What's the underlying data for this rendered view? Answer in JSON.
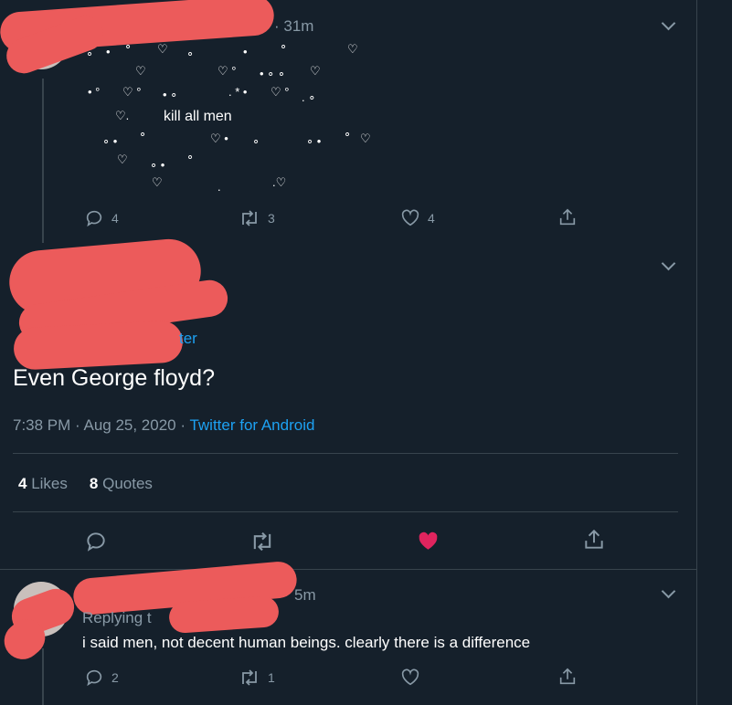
{
  "tweet1": {
    "time": "· 31m",
    "text": "kill all men",
    "actions": {
      "replies": "4",
      "retweets": "3",
      "likes": "4"
    }
  },
  "main_tweet": {
    "replying_fragment": "ter",
    "text": "Even George floyd?",
    "timestamp": "7:38 PM · Aug 25, 2020 · ",
    "source": "Twitter for Android",
    "stats": {
      "likes_count": "4",
      "likes_label": "Likes",
      "quotes_count": "8",
      "quotes_label": "Quotes"
    },
    "liked": true,
    "like_color": "#e0245e"
  },
  "tweet3": {
    "time": "5m",
    "replying_label": "Replying t",
    "text": "i said men, not decent human beings. clearly there is a difference",
    "actions": {
      "replies": "2",
      "retweets": "1"
    }
  },
  "colors": {
    "background": "#15202b",
    "accent": "#1da1f2",
    "redaction": "#ec5b5b"
  }
}
